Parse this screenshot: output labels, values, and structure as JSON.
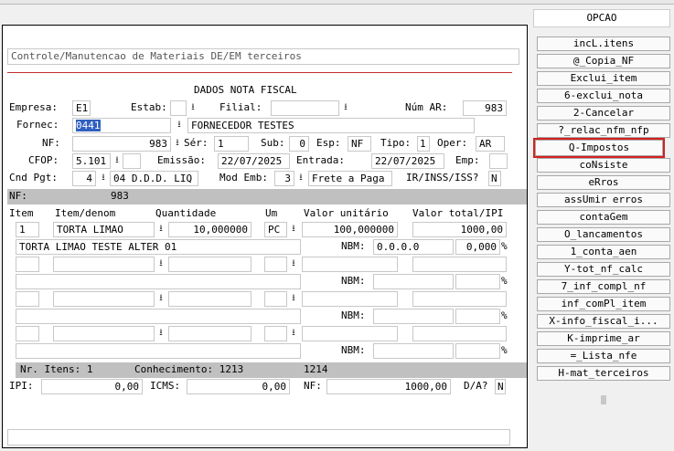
{
  "panel_title": "Controle/Manutencao de Materiais DE/EM terceiros",
  "section_title": "DADOS NOTA FISCAL",
  "labels": {
    "empresa": "Empresa:",
    "estab": "Estab:",
    "filial": "Filial:",
    "num_ar": "Núm AR:",
    "fornec": "Fornec:",
    "nf": "NF:",
    "ser": "Sér:",
    "sub": "Sub:",
    "esp": "Esp:",
    "tipo": "Tipo:",
    "oper": "Oper:",
    "cfop": "CFOP:",
    "emissao": "Emissão:",
    "entrada": "Entrada:",
    "emp": "Emp:",
    "cnd_pgt": "Cnd Pgt:",
    "mod_emb": "Mod Emb:",
    "ir": "IR/INSS/ISS?",
    "nbm": "NBM:",
    "pct": "%",
    "ipi": "IPI:",
    "icms": "ICMS:",
    "nf_total": "NF:",
    "da": "D/A?"
  },
  "values": {
    "empresa": "E1",
    "estab": "",
    "filial": "",
    "num_ar": "983",
    "fornec_code": "0441",
    "fornec_name": "FORNECEDOR TESTES",
    "nf": "983",
    "ser": "1",
    "sub": "0",
    "esp": "NF",
    "tipo": "1",
    "oper": "AR",
    "cfop": "5.101",
    "emissao": "22/07/2025",
    "entrada": "22/07/2025",
    "emp": "",
    "cnd_pgt_code": "4",
    "cnd_pgt_desc": "04 D.D.D. LIQ",
    "mod_emb_code": "3",
    "mod_emb_desc": "Frete a Paga",
    "ir": "N",
    "ipi": "0,00",
    "icms": "0,00",
    "nf_total": "1000,00",
    "da": "N"
  },
  "nf_bar": {
    "label": "NF:",
    "value": "983"
  },
  "grid_headers": {
    "item": "Item",
    "item_denom": "Item/denom",
    "quantidade": "Quantidade",
    "um": "Um",
    "valor_unitario": "Valor unitário",
    "valor_total": "Valor total/IPI"
  },
  "item1": {
    "item": "1",
    "denom": "TORTA LIMAO",
    "qtd": "10,000000",
    "um": "PC",
    "unit": "100,000000",
    "total": "1000,00",
    "desc": "TORTA LIMAO TESTE ALTER 01",
    "nbm": "0.0.0.0",
    "ipi_pct": "0,000"
  },
  "summary": {
    "itens": "Nr. Itens: 1",
    "conhecimento": "Conhecimento: 1213",
    "ref": "1214"
  },
  "menu": {
    "title": "OPCAO",
    "items": [
      "incL.itens",
      "@_Copia_NF",
      "Exclui_item",
      "6-exclui_nota",
      "2-Cancelar",
      "?_relac_nfm_nfp",
      "Q-Impostos",
      "coNsiste",
      "eRros",
      "assUmir erros",
      "contaGem",
      "O_lancamentos",
      "1_conta_aen",
      "Y-tot_nf_calc",
      "7_inf_compl_nf",
      "inf_comPl_item",
      "X-info_fiscal_i...",
      "K-imprime_ar",
      "=_Lista_nfe",
      "H-mat_terceiros"
    ],
    "highlight_color": "#d62020"
  }
}
